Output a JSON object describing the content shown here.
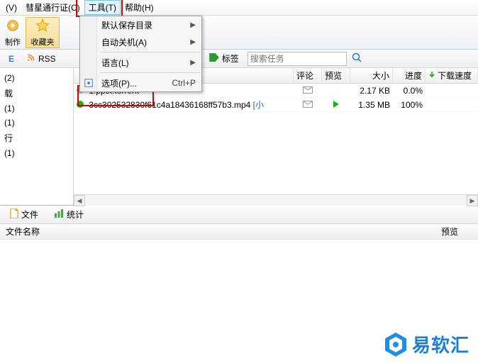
{
  "menubar": {
    "items": [
      "(V)",
      "彗星通行证(C)",
      "工具(T)",
      "帮助(H)"
    ],
    "highlight": 2
  },
  "dropdown": {
    "items": [
      {
        "label": "默认保存目录",
        "arrow": true
      },
      {
        "label": "自动关机(A)",
        "arrow": true
      },
      {
        "sep": true
      },
      {
        "label": "语言(L)",
        "arrow": true
      },
      {
        "sep": true
      },
      {
        "label": "选项(P)...",
        "hotkey": "Ctrl+P",
        "icon": "gear"
      }
    ]
  },
  "toolbar": {
    "make": "制作",
    "fav": "收藏夹"
  },
  "secondbar": {
    "e_label": "E",
    "rss_label": "RSS",
    "tag_label": "标签",
    "search_placeholder": "搜索任务"
  },
  "leftnav": [
    "(2)",
    "载",
    "(1)",
    "(1)",
    "行",
    "(1)"
  ],
  "grid": {
    "headers": {
      "comment": "评论",
      "preview": "预览",
      "size": "大小",
      "progress": "进度",
      "dlspeed": "下载速度"
    },
    "rows": [
      {
        "status_color": "#9e9e9e",
        "name": "1.pptx.torrent",
        "preview": "",
        "size": "2.17 KB",
        "progress": "0.0%"
      },
      {
        "status_color": "#17b40b",
        "name": "3cc302532830f61c4a18436168ff57b3.mp4",
        "suffix": "[小",
        "preview": "play",
        "size": "1.35 MB",
        "progress": "100%"
      }
    ],
    "dl_arrow_color": "#28a718"
  },
  "bottom": {
    "tab_file": "文件",
    "tab_stats": "统计",
    "col_filename": "文件名称",
    "col_preview": "预览"
  },
  "watermark": "易软汇"
}
